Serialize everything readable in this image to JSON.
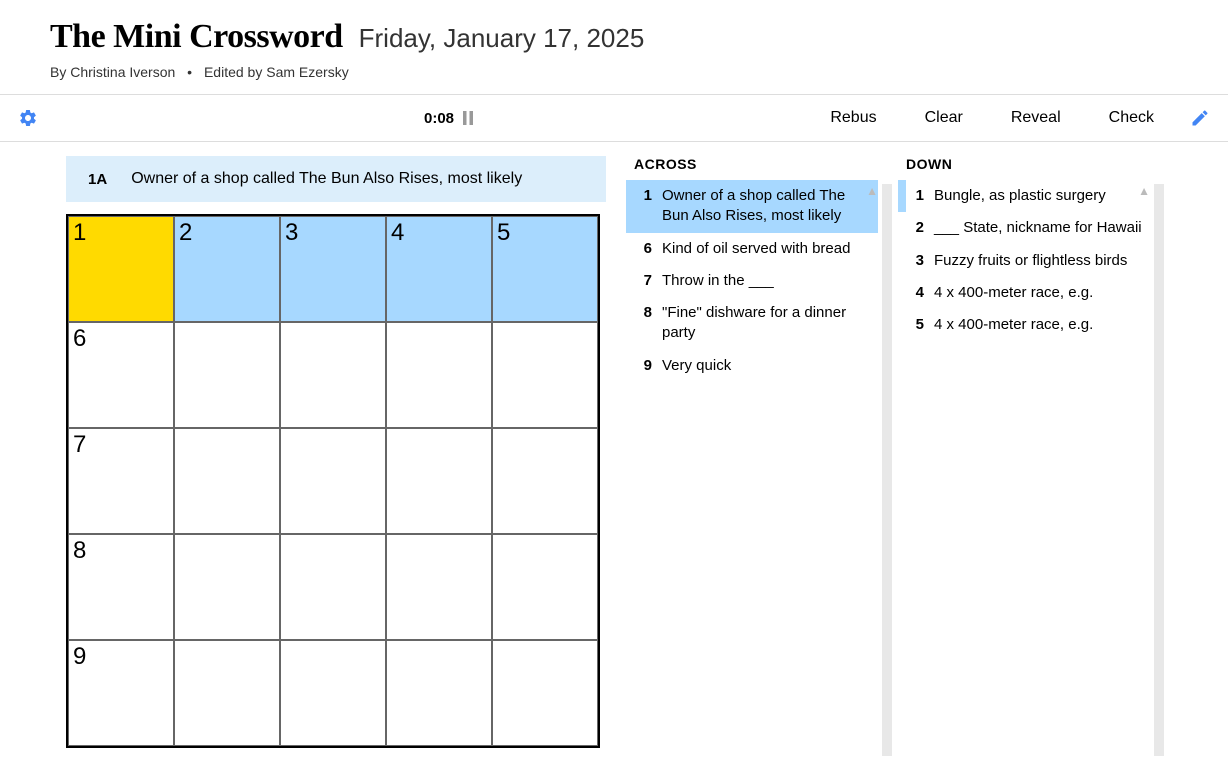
{
  "header": {
    "title": "The Mini Crossword",
    "date": "Friday, January 17, 2025",
    "by_label": "By",
    "author": "Christina Iverson",
    "edited_label": "Edited by",
    "editor": "Sam Ezersky"
  },
  "toolbar": {
    "timer": "0:08",
    "rebus": "Rebus",
    "clear": "Clear",
    "reveal": "Reveal",
    "check": "Check"
  },
  "current_clue": {
    "label": "1A",
    "text": "Owner of a shop called The Bun Also Rises, most likely"
  },
  "grid": {
    "rows": 5,
    "cols": 5,
    "cells": [
      {
        "n": "1",
        "state": "cur"
      },
      {
        "n": "2",
        "state": "hl"
      },
      {
        "n": "3",
        "state": "hl"
      },
      {
        "n": "4",
        "state": "hl"
      },
      {
        "n": "5",
        "state": "hl"
      },
      {
        "n": "6",
        "state": ""
      },
      {
        "n": "",
        "state": ""
      },
      {
        "n": "",
        "state": ""
      },
      {
        "n": "",
        "state": ""
      },
      {
        "n": "",
        "state": ""
      },
      {
        "n": "7",
        "state": ""
      },
      {
        "n": "",
        "state": ""
      },
      {
        "n": "",
        "state": ""
      },
      {
        "n": "",
        "state": ""
      },
      {
        "n": "",
        "state": ""
      },
      {
        "n": "8",
        "state": ""
      },
      {
        "n": "",
        "state": ""
      },
      {
        "n": "",
        "state": ""
      },
      {
        "n": "",
        "state": ""
      },
      {
        "n": "",
        "state": ""
      },
      {
        "n": "9",
        "state": ""
      },
      {
        "n": "",
        "state": ""
      },
      {
        "n": "",
        "state": ""
      },
      {
        "n": "",
        "state": ""
      },
      {
        "n": "",
        "state": ""
      }
    ]
  },
  "clues": {
    "across_label": "ACROSS",
    "down_label": "DOWN",
    "across": [
      {
        "n": "1",
        "text": "Owner of a shop called The Bun Also Rises, most likely",
        "active": true
      },
      {
        "n": "6",
        "text": "Kind of oil served with bread"
      },
      {
        "n": "7",
        "text": "Throw in the ___"
      },
      {
        "n": "8",
        "text": "\"Fine\" dishware for a dinner party"
      },
      {
        "n": "9",
        "text": "Very quick"
      }
    ],
    "down": [
      {
        "n": "1",
        "text": "Bungle, as plastic surgery",
        "semi": true
      },
      {
        "n": "2",
        "text": "___ State, nickname for Hawaii"
      },
      {
        "n": "3",
        "text": "Fuzzy fruits or flightless birds"
      },
      {
        "n": "4",
        "text": "4 x 400-meter race, e.g."
      },
      {
        "n": "5",
        "text": "4 x 400-meter race, e.g."
      }
    ]
  }
}
